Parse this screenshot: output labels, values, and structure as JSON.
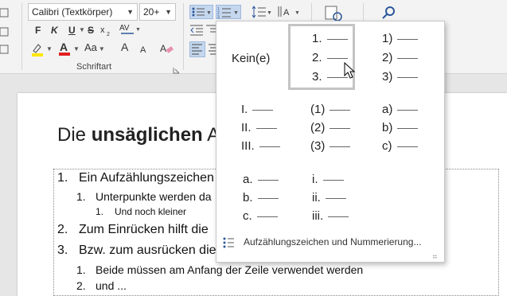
{
  "ribbon": {
    "font_name": "Calibri (Textkörper)",
    "font_size": "20+",
    "bold": "F",
    "italic": "K",
    "underline": "U",
    "strike": "S",
    "case_label": "Aa",
    "group_label": "Schriftart",
    "grow_font": "A",
    "shrink_font": "A"
  },
  "document": {
    "title_normal": "Die ",
    "title_bold": "unsäglichen",
    "title_rest": " A",
    "lines": [
      {
        "num": "1.",
        "text": "Ein Aufzählungszeichen"
      },
      {
        "num": "1.",
        "text": "Unterpunkte werden da"
      },
      {
        "num": "1.",
        "text": "Und noch kleiner"
      },
      {
        "num": "2.",
        "text": "Zum Einrücken hilft die"
      },
      {
        "num": "3.",
        "text": "Bzw. zum ausrücken die"
      },
      {
        "num": "1.",
        "text": "Beide müssen am Anfang der Zeile verwendet werden"
      },
      {
        "num": "2.",
        "text": "und ..."
      }
    ]
  },
  "numbering_menu": {
    "none_label": "Kein(e)",
    "formats": [
      {
        "id": "decimal",
        "items": [
          "1.",
          "2.",
          "3."
        ]
      },
      {
        "id": "paren_decimal",
        "items": [
          "1)",
          "2)",
          "3)"
        ]
      },
      {
        "id": "roman",
        "items": [
          "I.",
          "II.",
          "III."
        ]
      },
      {
        "id": "paren_enclosed",
        "items": [
          "(1)",
          "(2)",
          "(3)"
        ]
      },
      {
        "id": "alpha_paren",
        "items": [
          "a)",
          "b)",
          "c)"
        ]
      },
      {
        "id": "alpha_dot",
        "items": [
          "a.",
          "b.",
          "c."
        ]
      },
      {
        "id": "roman_lower",
        "items": [
          "i.",
          "ii.",
          "iii."
        ]
      }
    ],
    "footer_label": "Aufzählungszeichen und Nummerierung..."
  },
  "colors": {
    "highlight": "#ffe600",
    "font_color": "#e02020",
    "accent": "#2b579a"
  }
}
